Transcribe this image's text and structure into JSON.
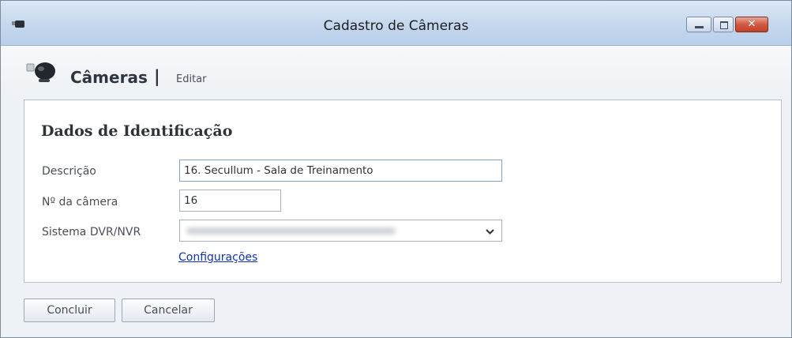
{
  "window": {
    "title": "Cadastro de Câmeras",
    "icon": "camera-icon",
    "controls": [
      "minimize-icon",
      "maximize-icon",
      "close-icon"
    ]
  },
  "header": {
    "icon": "camera-icon",
    "title": "Câmeras",
    "separator": "|",
    "subtitle": "Editar"
  },
  "form": {
    "section_title": "Dados de Identificação",
    "description_label": "Descrição",
    "description_value": "16. Secullum - Sala de Treinamento",
    "camera_number_label": "Nº da câmera",
    "camera_number_value": "16",
    "dvr_label": "Sistema DVR/NVR",
    "config_link": "Configurações"
  },
  "actions": {
    "confirm": "Concluir",
    "cancel": "Cancelar"
  },
  "colors": {
    "titlebar": "#c4d7ee",
    "close_button": "#cf5a42",
    "link": "#1133aa"
  }
}
